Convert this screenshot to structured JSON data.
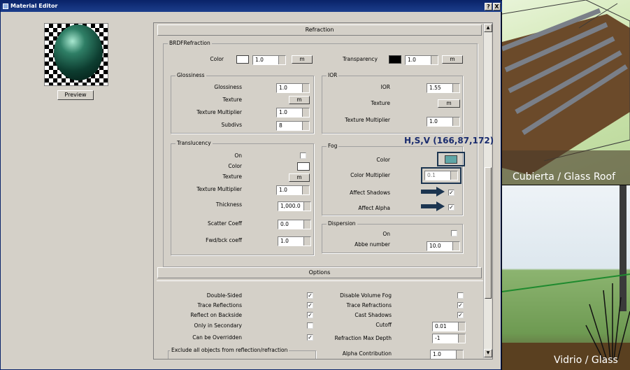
{
  "window": {
    "title": "Material Editor",
    "help_glyph": "?",
    "close_glyph": "X"
  },
  "preview": {
    "button_label": "Preview"
  },
  "rollouts": {
    "refraction": "Refraction",
    "options": "Options"
  },
  "brdf": {
    "group_label": "BRDFRefraction",
    "color_label": "Color",
    "color_value": "1.0",
    "transparency_label": "Transparency",
    "transparency_value": "1.0",
    "map_button": "m",
    "color_swatch": "#ffffff",
    "transparency_swatch": "#000000"
  },
  "glossiness": {
    "group_label": "Glossiness",
    "glossiness_label": "Glossiness",
    "glossiness_value": "1.0",
    "texture_label": "Texture",
    "texture_button": "m",
    "texture_multiplier_label": "Texture Multiplier",
    "texture_multiplier_value": "1.0",
    "subdivs_label": "Subdivs",
    "subdivs_value": "8"
  },
  "ior": {
    "group_label": "IOR",
    "ior_label": "IOR",
    "ior_value": "1.55",
    "texture_label": "Texture",
    "texture_button": "m",
    "texture_multiplier_label": "Texture Multiplier",
    "texture_multiplier_value": "1.0"
  },
  "translucency": {
    "group_label": "Translucency",
    "on_label": "On",
    "on_checked": "",
    "color_label": "Color",
    "color_swatch": "#ffffff",
    "texture_label": "Texture",
    "texture_button": "m",
    "texture_multiplier_label": "Texture Multiplier",
    "texture_multiplier_value": "1.0",
    "thickness_label": "Thickness",
    "thickness_value": "1,000.0",
    "scatter_label": "Scatter Coeff",
    "scatter_value": "0.0",
    "fwdbck_label": "Fwd/bck coeff",
    "fwdbck_value": "1.0"
  },
  "fog": {
    "group_label": "Fog",
    "color_label": "Color",
    "color_swatch": "#5fa6a6",
    "color_multiplier_label": "Color Multiplier",
    "color_multiplier_value": "0.1",
    "affect_shadows_label": "Affect Shadows",
    "affect_shadows_checked": "✓",
    "affect_alpha_label": "Affect Alpha",
    "affect_alpha_checked": "✓",
    "annotation": "H,S,V (166,87,172)",
    "annotation_color": "#1a2c6e"
  },
  "dispersion": {
    "group_label": "Dispersion",
    "on_label": "On",
    "on_checked": "",
    "abbe_label": "Abbe number",
    "abbe_value": "10.0"
  },
  "options": {
    "left": [
      {
        "label": "Double-Sided",
        "checked": "✓"
      },
      {
        "label": "Trace Reflections",
        "checked": "✓"
      },
      {
        "label": "Reflect on Backside",
        "checked": "✓"
      },
      {
        "label": "Only in Secondary",
        "checked": ""
      },
      {
        "label": "Can be Overridden",
        "checked": "✓"
      }
    ],
    "right_checks": [
      {
        "label": "Disable Volume Fog",
        "checked": ""
      },
      {
        "label": "Trace Refractions",
        "checked": "✓"
      },
      {
        "label": "Cast Shadows",
        "checked": "✓"
      }
    ],
    "cutoff_label": "Cutoff",
    "cutoff_value": "0.01",
    "max_depth_label": "Refraction Max Depth",
    "max_depth_value": "-1",
    "alpha_label": "Alpha Contribution",
    "alpha_value": "1.0",
    "exclude_label": "Exclude all objects from reflection/refraction"
  },
  "photos": {
    "top_caption": "Cubierta / Glass Roof",
    "bottom_caption": "Vidrio / Glass"
  }
}
